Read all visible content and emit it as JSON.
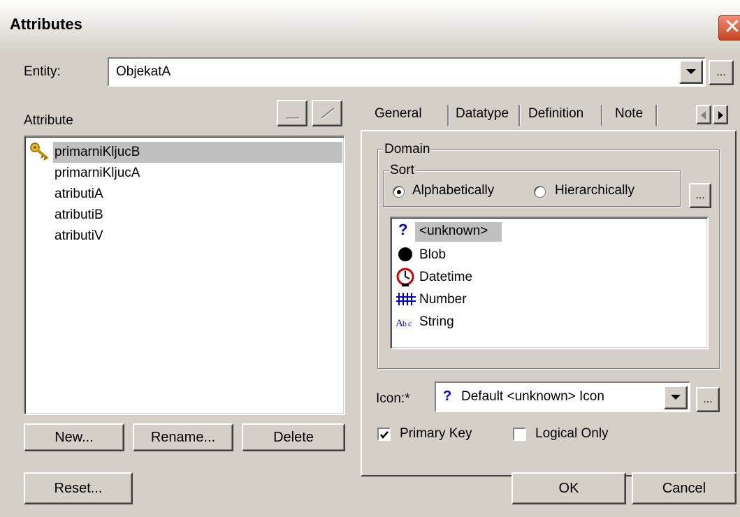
{
  "window": {
    "title": "Attributes",
    "close_glyph": "✕"
  },
  "entity": {
    "label": "Entity:",
    "value": "ObjekatA",
    "browse_label": "..."
  },
  "attributes": {
    "label": "Attribute",
    "items": [
      {
        "name": "primarniKljucB",
        "selected": true,
        "icon": "key-icon"
      },
      {
        "name": "primarniKljucA"
      },
      {
        "name": "atributiA"
      },
      {
        "name": "atributiB"
      },
      {
        "name": "atributiV"
      }
    ],
    "buttons": {
      "new": "New...",
      "rename": "Rename...",
      "delete": "Delete"
    }
  },
  "tabs": {
    "items": [
      "General",
      "Datatype",
      "Definition",
      "Note"
    ],
    "active": "General"
  },
  "general": {
    "domain_label": "Domain",
    "sort_label": "Sort",
    "sort_alpha": "Alphabetically",
    "sort_hier": "Hierarchically",
    "sort_selected": "Alphabetically",
    "sort_browse": "...",
    "domains": [
      {
        "name": "<unknown>",
        "icon": "question-icon",
        "selected": true
      },
      {
        "name": "Blob",
        "icon": "blob-icon"
      },
      {
        "name": "Datetime",
        "icon": "clock-icon"
      },
      {
        "name": "Number",
        "icon": "number-icon"
      },
      {
        "name": "String",
        "icon": "string-icon"
      }
    ],
    "icon_label": "Icon:*",
    "icon_value": "Default <unknown> Icon",
    "icon_glyph": "?",
    "icon_browse": "...",
    "primary_key_label": "Primary Key",
    "primary_key_checked": true,
    "logical_only_label": "Logical Only",
    "logical_only_checked": false
  },
  "footer": {
    "reset": "Reset...",
    "ok": "OK",
    "cancel": "Cancel"
  },
  "colors": {
    "face": "#d4d0c8",
    "selection": "#c0c0c0",
    "icon_blue": "#0000cc",
    "clock_red": "#cc0000"
  }
}
